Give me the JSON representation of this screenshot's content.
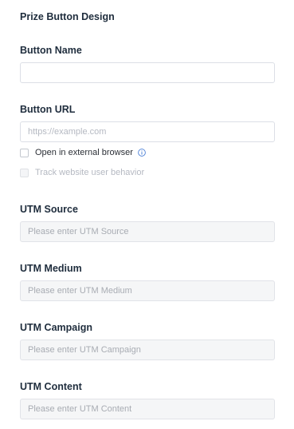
{
  "section": {
    "title": "Prize Button Design"
  },
  "button_name": {
    "label": "Button Name",
    "value": "",
    "placeholder": ""
  },
  "button_url": {
    "label": "Button URL",
    "placeholder": "https://example.com",
    "open_external_label": "Open in external browser",
    "open_external_checked": false,
    "track_behavior_label": "Track website user behavior",
    "track_behavior_checked": false,
    "track_behavior_disabled": true
  },
  "utm_source": {
    "label": "UTM Source",
    "placeholder": "Please enter UTM Source"
  },
  "utm_medium": {
    "label": "UTM Medium",
    "placeholder": "Please enter UTM Medium"
  },
  "utm_campaign": {
    "label": "UTM Campaign",
    "placeholder": "Please enter UTM Campaign"
  },
  "utm_content": {
    "label": "UTM Content",
    "placeholder": "Please enter UTM Content"
  },
  "icons": {
    "info": "info-icon"
  },
  "colors": {
    "info_icon": "#4a7fd6",
    "label_text": "#1f2d3d"
  }
}
